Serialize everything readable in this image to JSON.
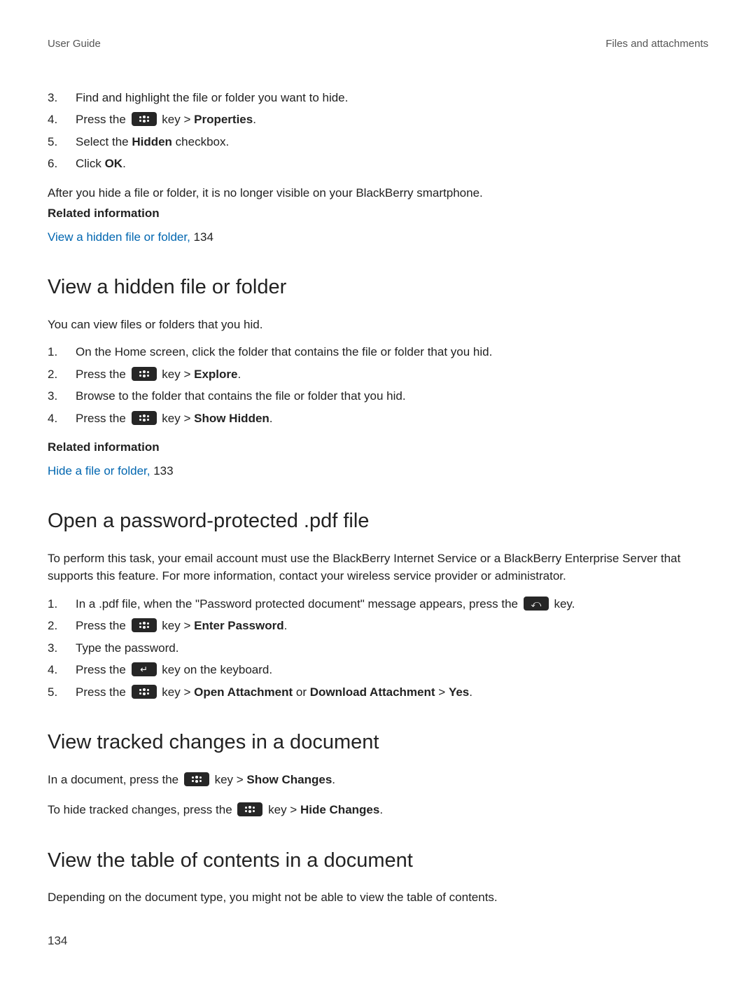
{
  "header": {
    "left": "User Guide",
    "right": "Files and attachments"
  },
  "hideSection": {
    "steps": {
      "s3": "Find and highlight the file or folder you want to hide.",
      "s4_prefix": "Press the ",
      "s4_mid": " key > ",
      "s4_bold": "Properties",
      "s4_suffix": ".",
      "s5_prefix": "Select the ",
      "s5_bold": "Hidden",
      "s5_suffix": " checkbox.",
      "s6_prefix": "Click ",
      "s6_bold": "OK",
      "s6_suffix": "."
    },
    "after": "After you hide a file or folder, it is no longer visible on your BlackBerry smartphone.",
    "relatedLabel": "Related information",
    "linkText": "View a hidden file or folder, ",
    "linkPage": "134"
  },
  "viewHidden": {
    "title": "View a hidden file or folder",
    "intro": "You can view files or folders that you hid.",
    "steps": {
      "s1": "On the Home screen, click the folder that contains the file or folder that you hid.",
      "s2_prefix": "Press the ",
      "s2_mid": " key > ",
      "s2_bold": "Explore",
      "s2_suffix": ".",
      "s3": "Browse to the folder that contains the file or folder that you hid.",
      "s4_prefix": "Press the ",
      "s4_mid": " key > ",
      "s4_bold": "Show Hidden",
      "s4_suffix": "."
    },
    "relatedLabel": "Related information",
    "linkText": "Hide a file or folder, ",
    "linkPage": "133"
  },
  "openPdf": {
    "title": "Open a password-protected .pdf file",
    "intro": "To perform this task, your email account must use the BlackBerry Internet Service or a BlackBerry Enterprise Server that supports this feature. For more information, contact your wireless service provider or administrator.",
    "steps": {
      "s1_prefix": "In a .pdf file, when the \"Password protected document\" message appears, press the ",
      "s1_suffix": " key.",
      "s2_prefix": "Press the ",
      "s2_mid": " key > ",
      "s2_bold": "Enter Password",
      "s2_suffix": ".",
      "s3": "Type the password.",
      "s4_prefix": "Press the ",
      "s4_suffix": " key on the keyboard.",
      "s5_prefix": "Press the ",
      "s5_mid": " key > ",
      "s5_bold1": "Open Attachment",
      "s5_or": " or ",
      "s5_bold2": "Download Attachment",
      "s5_gt": " > ",
      "s5_bold3": "Yes",
      "s5_suffix": "."
    }
  },
  "tracked": {
    "title": "View tracked changes in a document",
    "line1_prefix": "In a document, press the ",
    "line1_mid": " key > ",
    "line1_bold": "Show Changes",
    "line1_suffix": ".",
    "line2_prefix": "To hide tracked changes, press the ",
    "line2_mid": " key > ",
    "line2_bold": "Hide Changes",
    "line2_suffix": "."
  },
  "toc": {
    "title": "View the table of contents in a document",
    "intro": "Depending on the document type, you might not be able to view the table of contents."
  },
  "pageNumber": "134"
}
